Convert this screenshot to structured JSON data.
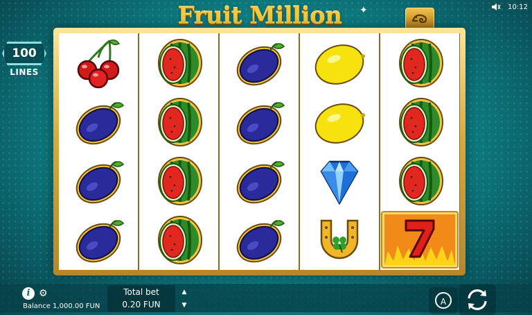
{
  "status_bar": {
    "time": "10:12",
    "volume_icon": "speaker-muted-icon"
  },
  "logo": {
    "text": "Fruit Million"
  },
  "lines_badge": {
    "count": "100",
    "label": "LINES"
  },
  "reels": [
    [
      "cherry",
      "plum",
      "plum",
      "plum"
    ],
    [
      "watermelon",
      "watermelon",
      "watermelon",
      "watermelon"
    ],
    [
      "plum",
      "plum",
      "plum",
      "plum"
    ],
    [
      "lemon",
      "lemon",
      "diamond",
      "horseshoe"
    ],
    [
      "watermelon",
      "watermelon",
      "watermelon",
      "seven"
    ]
  ],
  "bottom_bar": {
    "balance": "Balance 1,000.00 FUN",
    "total_bet_label": "Total bet",
    "total_bet_value": "0.20 FUN",
    "bet_up_icon": "triangle-up-icon",
    "bet_down_icon": "triangle-down-icon",
    "auto_label": "A",
    "spin_icon": "spin-arrows-icon"
  },
  "colors": {
    "accent_gold": "#f4c93b",
    "background_teal": "#0f8e92",
    "frame_gold": "#d8a93a"
  }
}
